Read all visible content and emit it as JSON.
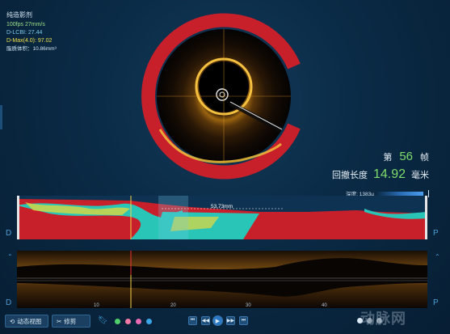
{
  "info": {
    "title": "纯造影剂",
    "fps": "100fps 27mm/s",
    "lcbi": "D-LCBI: 27.44",
    "dmax": "D-Max(4.0): 97.02",
    "volume": "脂质体积：10.86mm³"
  },
  "frame": {
    "prefix": "第",
    "value": "56",
    "suffix": "帧"
  },
  "pullback": {
    "label": "回撤长度",
    "value": "14.92",
    "unit": "毫米"
  },
  "depth": {
    "label": "深度: 1383μ"
  },
  "lumen_view": {
    "measurement": "53.73mm"
  },
  "side_letters": {
    "left": "D",
    "right": "P"
  },
  "long_view": {
    "ticks": [
      "10",
      "20",
      "30",
      "40"
    ]
  },
  "toolbar": {
    "dynamic_view": "动态视图",
    "edit": "修剪",
    "dots": [
      "#4fd06a",
      "#f07aa5",
      "#e86ab2",
      "#3aa6e8"
    ],
    "playback": [
      "⏮",
      "◀◀",
      "▶",
      "▶▶",
      "⏭"
    ]
  },
  "watermark": "动脉网",
  "colors": {
    "lipid": "#c8202a",
    "calcium": "#3bd1c8",
    "fibrous": "#e7d83a",
    "background": "#0a2a45"
  }
}
